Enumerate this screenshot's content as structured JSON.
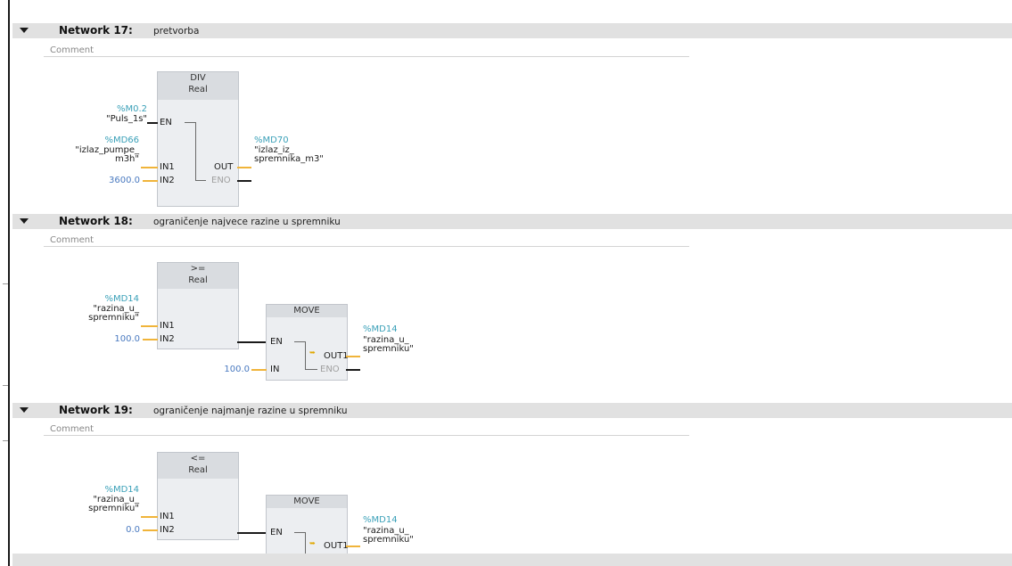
{
  "networks": [
    {
      "title": "Network 17:",
      "description": "pretvorba",
      "comment": "Comment",
      "block": {
        "name": "DIV",
        "type": "Real"
      },
      "pins": {
        "en": "EN",
        "in1": "IN1",
        "in2": "IN2",
        "out": "OUT",
        "eno": "ENO"
      },
      "en_operand": {
        "address": "%M0.2",
        "symbol": "\"Puls_1s\""
      },
      "in1_operand": {
        "address": "%MD66",
        "symbol_line1": "\"izlaz_pumpe_",
        "symbol_line2": "m3h\""
      },
      "in2_value": "3600.0",
      "out_operand": {
        "address": "%MD70",
        "symbol_line1": "\"izlaz_iz_",
        "symbol_line2": "spremnika_m3\""
      }
    },
    {
      "title": "Network 18:",
      "description": "ograničenje najvece razine u spremniku",
      "comment": "Comment",
      "compare": {
        "name": ">=",
        "type": "Real"
      },
      "pins": {
        "in1": "IN1",
        "in2": "IN2",
        "en": "EN",
        "in": "IN",
        "out1": "OUT1",
        "eno": "ENO"
      },
      "in1_operand": {
        "address": "%MD14",
        "symbol_line1": "\"razina_u_",
        "symbol_line2": "spremniku\""
      },
      "in2_value": "100.0",
      "move": {
        "name": "MOVE"
      },
      "move_in_value": "100.0",
      "out1_operand": {
        "address": "%MD14",
        "symbol_line1": "\"razina_u_",
        "symbol_line2": "spremniku\""
      }
    },
    {
      "title": "Network 19:",
      "description": "ograničenje najmanje razine u spremniku",
      "comment": "Comment",
      "compare": {
        "name": "<=",
        "type": "Real"
      },
      "pins": {
        "in1": "IN1",
        "in2": "IN2",
        "en": "EN",
        "out1": "OUT1"
      },
      "in1_operand": {
        "address": "%MD14",
        "symbol_line1": "\"razina_u_",
        "symbol_line2": "spremniku\""
      },
      "in2_value": "0.0",
      "move": {
        "name": "MOVE"
      },
      "out1_operand": {
        "address": "%MD14",
        "symbol_line1": "\"razina_u_",
        "symbol_line2": "spremniku\""
      }
    }
  ]
}
